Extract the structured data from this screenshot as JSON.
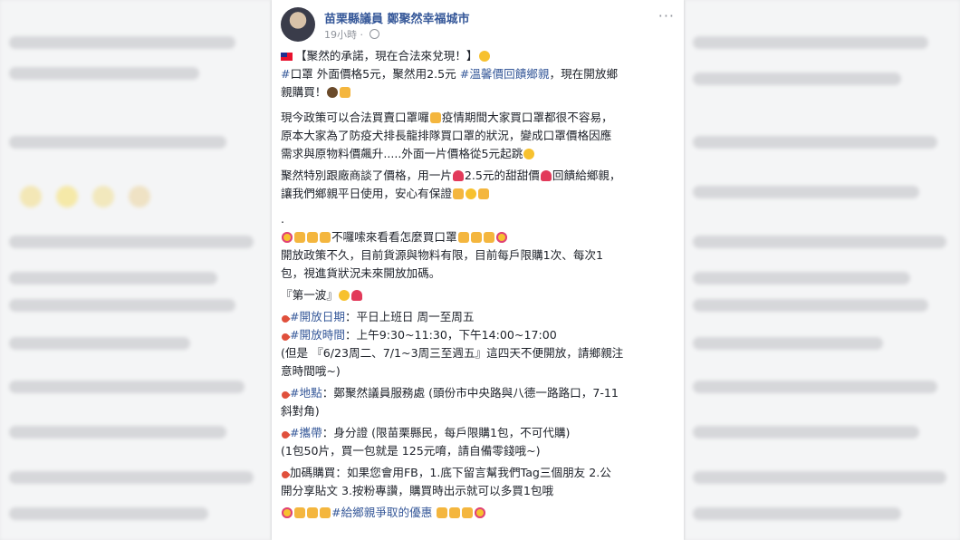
{
  "post": {
    "page_name": "苗栗縣議員 鄭聚然幸福城市",
    "time": "19小時",
    "lines": [
      "【聚然的承諾，現在合法來兌現！】",
      "口罩 外面價格5元，聚然用2.5元 ",
      "溫馨價回饋鄉親",
      "，現在開放鄉",
      "親購買！",
      "現今政策可以合法買賣口罩囉",
      "疫情期間大家買口罩都很不容易，",
      "原本大家為了防疫犬排長龍排隊買口罩的狀況，變成口罩價格因應",
      "需求與原物料價飆升.....外面一片價格從5元起跳",
      "聚然特別跟廠商談了價格，用一片",
      "2.5元的甜甜價",
      "回饋給鄉親，",
      "讓我們鄉親平日使用，安心有保證",
      ".",
      "不囉嗦來看看怎麼買口罩",
      "開放政策不久，目前貨源與物料有限，目前每戶限購1次、每次1",
      "包，視進貨狀況未來開放加碼。",
      "『第一波』",
      "#開放日期",
      "：平日上班日 周一至周五",
      "#開放時間",
      "：上午9:30~11:30，下午14:00~17:00",
      "(但是 『6/23周二、7/1~3周三至週五』這四天不便開放，請鄉親注",
      "意時間哦~)",
      "#地點",
      "：鄭聚然議員服務處 (頭份市中央路與八德一路路口，7-11",
      "斜對角)",
      "#攜帶",
      "：身分證 (限苗栗縣民，每戶限購1包，不可代購)",
      "(1包50片，買一包就是 125元唷，請自備零錢哦~)",
      "加碼購買：如果您會用FB，1.底下留言幫我們Tag三個朋友 2.公",
      "開分享貼文 3.按粉專讚，購買時出示就可以多買1包哦",
      "#給鄉親爭取的優惠",
      "#",
      "…"
    ]
  },
  "colors": {
    "link": "#365899",
    "text": "#1d2129",
    "meta": "#90949c"
  }
}
